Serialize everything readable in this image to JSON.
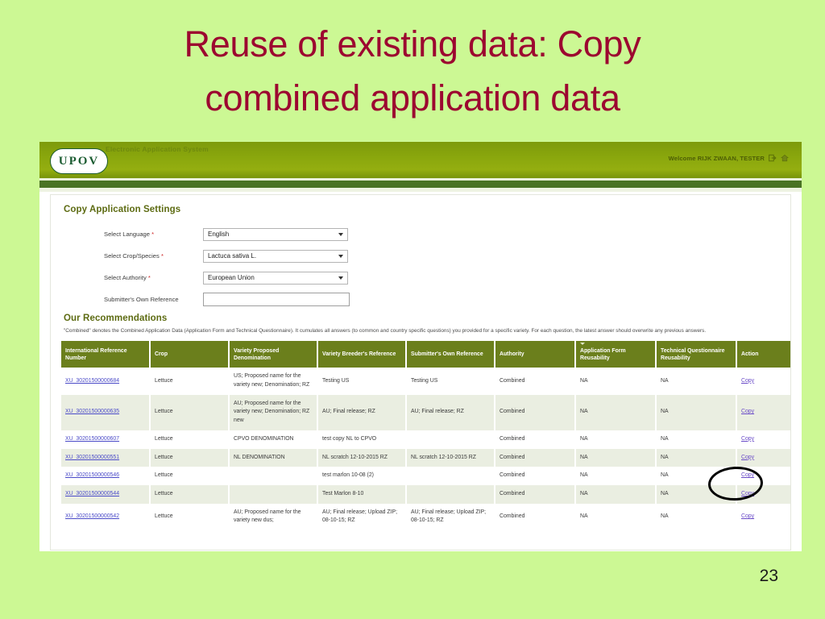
{
  "slide": {
    "title_line1": "Reuse of existing data: Copy",
    "title_line2": "combined application data",
    "page_number": "23",
    "title_color": "#9c0730",
    "background_color": "#ccf894"
  },
  "app": {
    "logo_text": "UPOV",
    "system_name": "Electronic Application System",
    "welcome_text": "Welcome RIJK ZWAAN, TESTER",
    "logout_icon": "logout-icon",
    "home_icon": "home-icon",
    "header_color": "#8aa70d"
  },
  "settings": {
    "section_title": "Copy Application Settings",
    "fields": [
      {
        "label": "Select Language",
        "required": "*",
        "value": "English",
        "type": "select"
      },
      {
        "label": "Select Crop/Species",
        "required": "*",
        "value": "Lactuca sativa L.",
        "type": "select"
      },
      {
        "label": "Select Authority",
        "required": "*",
        "value": "European Union",
        "type": "select"
      },
      {
        "label": "Submitter's Own Reference",
        "required": "",
        "value": "",
        "type": "text"
      }
    ]
  },
  "recommendations": {
    "section_title": "Our Recommendations",
    "note": "\"Combined\" denotes the Combined Application Data (Application Form and Technical Questionnaire). It cumulates all answers (to common and country specific questions) you provided for a specific variety. For each question, the latest answer should overwrite any previous answers.",
    "columns": [
      "International Reference Number",
      "Crop",
      "Variety Proposed Denomination",
      "Variety Breeder's Reference",
      "Submitter's Own Reference",
      "Authority",
      "Application Form Reusability",
      "Technical Questionnaire Reusability",
      "Action"
    ],
    "sorted_column_index": 6,
    "action_label": "Copy",
    "rows": [
      {
        "reference": "XU_30201500000684",
        "crop": "Lettuce",
        "denomination": "US; Proposed name for the variety new; Denomination; RZ",
        "breeder_reference": "Testing US",
        "own_reference": "Testing US",
        "authority": "Combined",
        "application_form_reusability": "NA",
        "technical_questionnaire_reusability": "NA",
        "action": "Copy"
      },
      {
        "reference": "XU_30201500000635",
        "crop": "Lettuce",
        "denomination": "AU; Proposed name for the variety new; Denomination; RZ new",
        "breeder_reference": "AU; Final release; RZ",
        "own_reference": "AU; Final release; RZ",
        "authority": "Combined",
        "application_form_reusability": "NA",
        "technical_questionnaire_reusability": "NA",
        "action": "Copy"
      },
      {
        "reference": "XU_30201500000607",
        "crop": "Lettuce",
        "denomination": "CPVO DENOMINATION",
        "breeder_reference": "test copy NL to CPVO",
        "own_reference": "",
        "authority": "Combined",
        "application_form_reusability": "NA",
        "technical_questionnaire_reusability": "NA",
        "action": "Copy"
      },
      {
        "reference": "XU_30201500000551",
        "crop": "Lettuce",
        "denomination": "NL DENOMINATION",
        "breeder_reference": "NL scratch 12-10-2015 RZ",
        "own_reference": "NL scratch 12-10-2015 RZ",
        "authority": "Combined",
        "application_form_reusability": "NA",
        "technical_questionnaire_reusability": "NA",
        "action": "Copy"
      },
      {
        "reference": "XU_30201500000546",
        "crop": "Lettuce",
        "denomination": "",
        "breeder_reference": "test marlon 10-08 (2)",
        "own_reference": "",
        "authority": "Combined",
        "application_form_reusability": "NA",
        "technical_questionnaire_reusability": "NA",
        "action": "Copy"
      },
      {
        "reference": "XU_30201500000544",
        "crop": "Lettuce",
        "denomination": "",
        "breeder_reference": "Test Marlon 8-10",
        "own_reference": "",
        "authority": "Combined",
        "application_form_reusability": "NA",
        "technical_questionnaire_reusability": "NA",
        "action": "Copy"
      },
      {
        "reference": "XU_30201500000542",
        "crop": "Lettuce",
        "denomination": "AU; Proposed name for the variety new dus;",
        "breeder_reference": "AU; Final release; Upload ZIP; 08-10-15; RZ",
        "own_reference": "AU; Final release; Upload ZIP; 08-10-15; RZ",
        "authority": "Combined",
        "application_form_reusability": "NA",
        "technical_questionnaire_reusability": "NA",
        "action": "Copy"
      }
    ]
  },
  "annotation": {
    "shape": "ellipse",
    "target": "copy-link-row-4",
    "color": "#000000"
  }
}
